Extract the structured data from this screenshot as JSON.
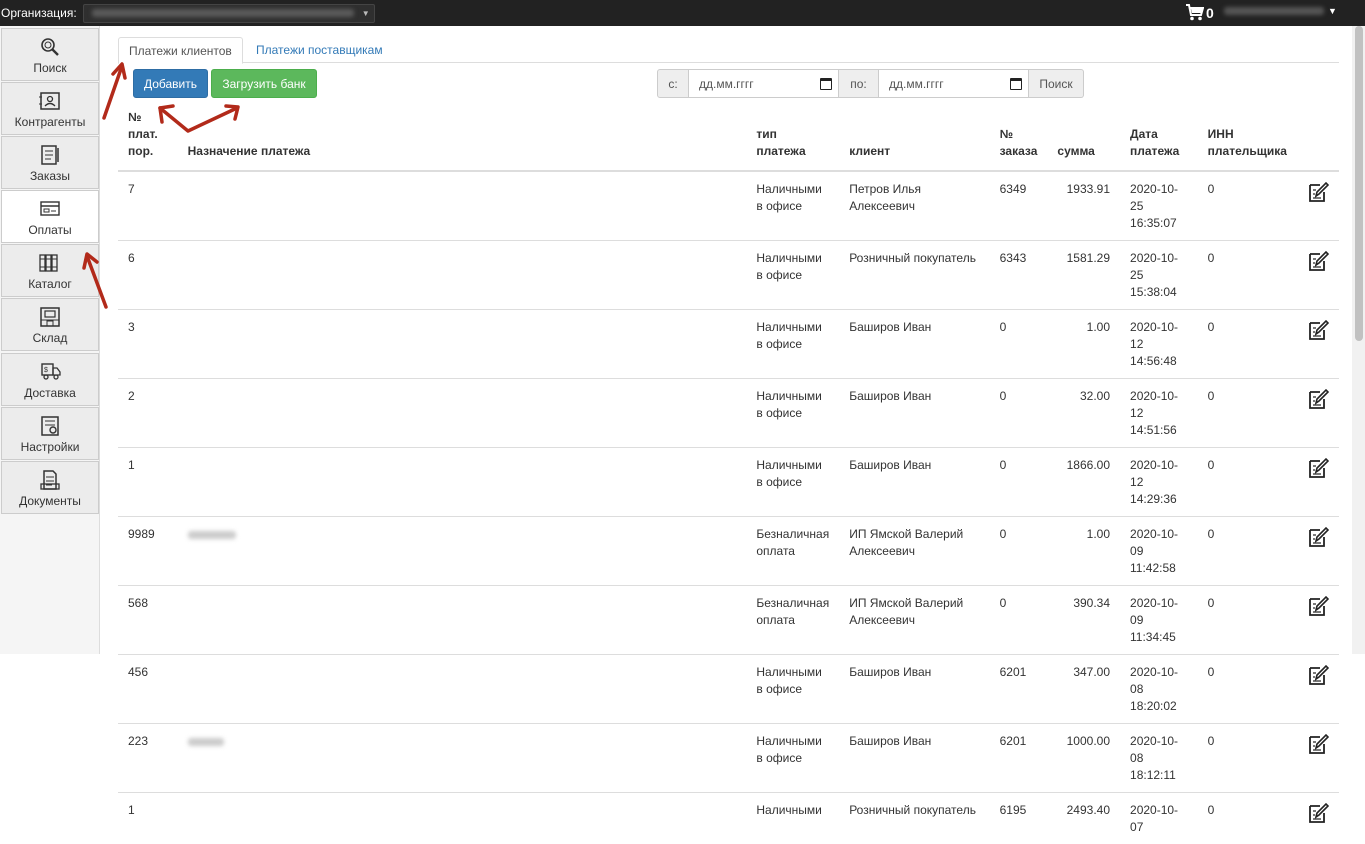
{
  "topbar": {
    "org_label": "Организация:",
    "cart_count": "0"
  },
  "sidebar": {
    "items": [
      {
        "label": "Поиск",
        "icon": "search-icon"
      },
      {
        "label": "Контрагенты",
        "icon": "contacts-icon"
      },
      {
        "label": "Заказы",
        "icon": "orders-icon"
      },
      {
        "label": "Оплаты",
        "icon": "payments-icon",
        "active": true
      },
      {
        "label": "Каталог",
        "icon": "catalog-icon"
      },
      {
        "label": "Склад",
        "icon": "warehouse-icon"
      },
      {
        "label": "Доставка",
        "icon": "delivery-icon"
      },
      {
        "label": "Настройки",
        "icon": "settings-icon"
      },
      {
        "label": "Документы",
        "icon": "documents-icon"
      }
    ]
  },
  "tabs": {
    "clients": "Платежи клиентов",
    "suppliers": "Платежи поставщикам"
  },
  "toolbar": {
    "add_label": "Добавить",
    "upload_label": "Загрузить банк"
  },
  "filter": {
    "from_label": "с:",
    "from_placeholder": "дд.мм.гггг",
    "to_label": "по:",
    "to_placeholder": "дд.мм.гггг",
    "search_label": "Поиск"
  },
  "table": {
    "headers": {
      "num_l1": "№",
      "num_l2": "плат.",
      "num_l3": "пор.",
      "purpose": "Назначение платежа",
      "type": "тип платежа",
      "client": "клиент",
      "order_l1": "№",
      "order_l2": "заказа",
      "sum": "сумма",
      "date_l1": "Дата",
      "date_l2": "платежа",
      "inn_l1": "ИНН",
      "inn_l2": "плательщика"
    },
    "rows": [
      {
        "num": "7",
        "type_l1": "Наличными",
        "type_l2": "в офисе",
        "client_l1": "Петров Илья",
        "client_l2": "Алексеевич",
        "order": "6349",
        "sum": "1933.91",
        "date_l1": "2020-10-25",
        "date_l2": "16:35:07",
        "inn": "0"
      },
      {
        "num": "6",
        "type_l1": "Наличными",
        "type_l2": "в офисе",
        "client_l1": "Розничный покупатель",
        "client_l2": "",
        "order": "6343",
        "sum": "1581.29",
        "date_l1": "2020-10-25",
        "date_l2": "15:38:04",
        "inn": "0"
      },
      {
        "num": "3",
        "type_l1": "Наличными",
        "type_l2": "в офисе",
        "client_l1": "Баширов Иван",
        "client_l2": "",
        "order": "0",
        "sum": "1.00",
        "date_l1": "2020-10-12",
        "date_l2": "14:56:48",
        "inn": "0"
      },
      {
        "num": "2",
        "type_l1": "Наличными",
        "type_l2": "в офисе",
        "client_l1": "Баширов Иван",
        "client_l2": "",
        "order": "0",
        "sum": "32.00",
        "date_l1": "2020-10-12",
        "date_l2": "14:51:56",
        "inn": "0"
      },
      {
        "num": "1",
        "type_l1": "Наличными",
        "type_l2": "в офисе",
        "client_l1": "Баширов Иван",
        "client_l2": "",
        "order": "0",
        "sum": "1866.00",
        "date_l1": "2020-10-12",
        "date_l2": "14:29:36",
        "inn": "0"
      },
      {
        "num": "9989",
        "type_l1": "Безналичная",
        "type_l2": "оплата",
        "client_l1": "ИП Ямской Валерий",
        "client_l2": "Алексеевич",
        "order": "0",
        "sum": "1.00",
        "date_l1": "2020-10-09",
        "date_l2": "11:42:58",
        "inn": "0"
      },
      {
        "num": "568",
        "type_l1": "Безналичная",
        "type_l2": "оплата",
        "client_l1": "ИП Ямской Валерий",
        "client_l2": "Алексеевич",
        "order": "0",
        "sum": "390.34",
        "date_l1": "2020-10-09",
        "date_l2": "11:34:45",
        "inn": "0"
      },
      {
        "num": "456",
        "type_l1": "Наличными",
        "type_l2": "в офисе",
        "client_l1": "Баширов Иван",
        "client_l2": "",
        "order": "6201",
        "sum": "347.00",
        "date_l1": "2020-10-08",
        "date_l2": "18:20:02",
        "inn": "0"
      },
      {
        "num": "223",
        "type_l1": "Наличными",
        "type_l2": "в офисе",
        "client_l1": "Баширов Иван",
        "client_l2": "",
        "order": "6201",
        "sum": "1000.00",
        "date_l1": "2020-10-08",
        "date_l2": "18:12:11",
        "inn": "0"
      },
      {
        "num": "1",
        "type_l1": "Наличными",
        "type_l2": "",
        "client_l1": "Розничный покупатель",
        "client_l2": "",
        "order": "6195",
        "sum": "2493.40",
        "date_l1": "2020-10-07",
        "date_l2": "",
        "inn": "0"
      }
    ]
  }
}
